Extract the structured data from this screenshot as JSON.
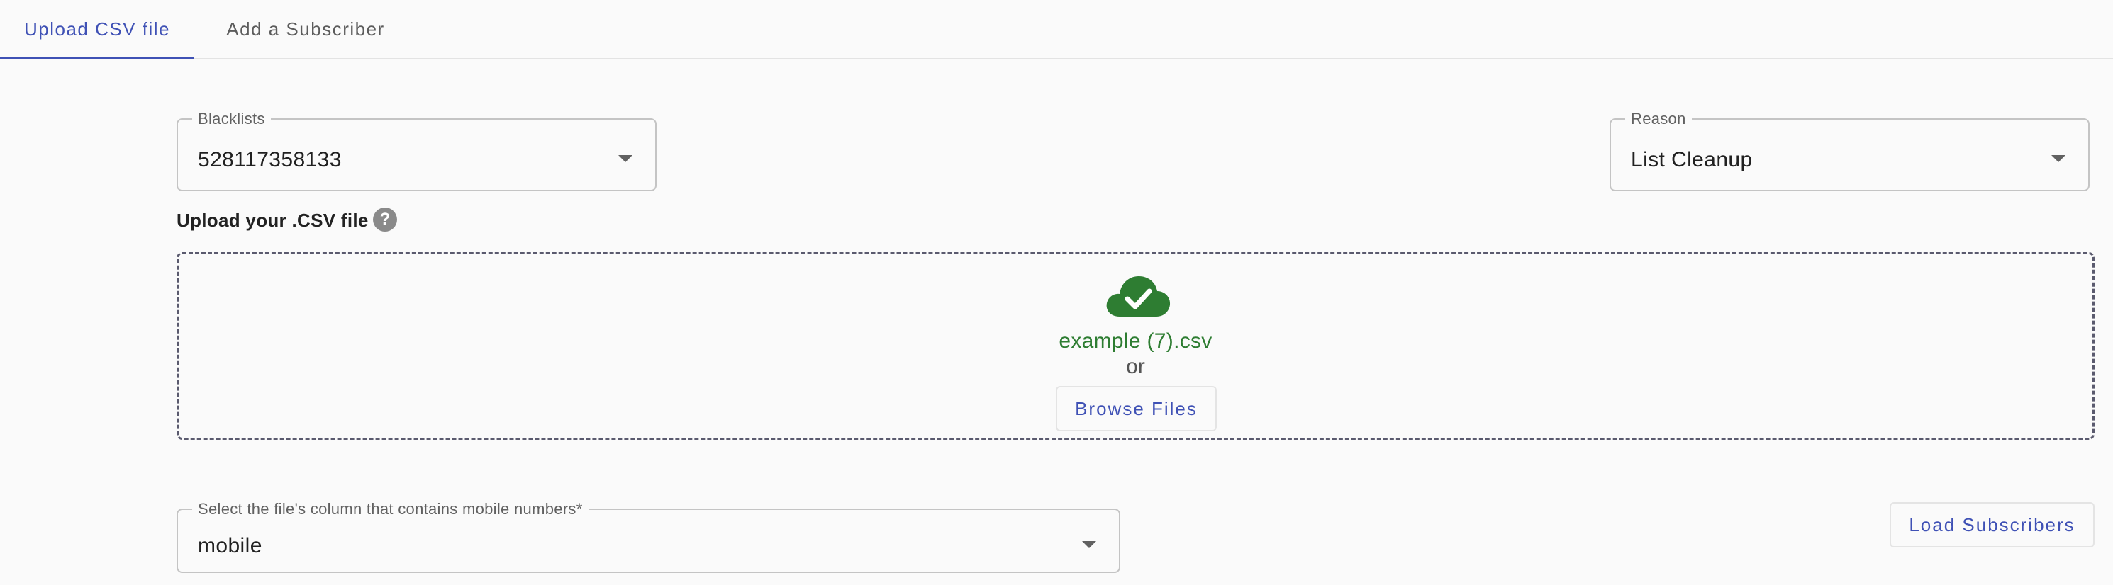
{
  "tabs": [
    {
      "label": "Upload CSV file",
      "active": true
    },
    {
      "label": "Add a Subscriber",
      "active": false
    }
  ],
  "blacklists": {
    "label": "Blacklists",
    "value": "528117358133"
  },
  "reason": {
    "label": "Reason",
    "value": "List Cleanup"
  },
  "upload": {
    "label": "Upload your .CSV file",
    "help_icon": "?",
    "file_name": "example (7).csv",
    "or_text": "or",
    "browse_label": "Browse Files",
    "icon": "cloud-check-icon"
  },
  "column_select": {
    "label": "Select the file's column that contains mobile numbers*",
    "value": "mobile"
  },
  "load_button": "Load Subscribers",
  "colors": {
    "accent": "#3f51b5",
    "success": "#2e7d32",
    "help": "#8a8a8a"
  }
}
